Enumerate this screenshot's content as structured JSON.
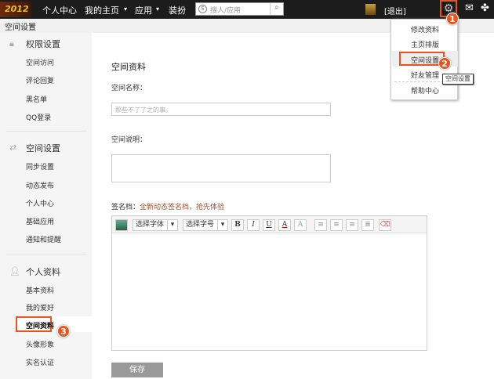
{
  "topbar": {
    "logo": "2012",
    "nav": [
      "个人中心",
      "我的主页",
      "应用",
      "装扮"
    ],
    "search_placeholder": "搜人/应用",
    "logout": "[退出]"
  },
  "breadcrumb": "空间设置",
  "sidebar": {
    "sections": [
      {
        "title": "权限设置",
        "icon": "lock-icon",
        "items": [
          "空间访问",
          "评论回复",
          "黑名单",
          "QQ登录"
        ]
      },
      {
        "title": "空间设置",
        "icon": "sync-icon",
        "items": [
          "同步设置",
          "动态发布",
          "个人中心",
          "基础应用",
          "通知和提醒"
        ]
      },
      {
        "title": "个人资料",
        "icon": "user-icon",
        "items": [
          "基本资料",
          "我的爱好",
          "空间资料",
          "头像形象",
          "实名认证"
        ]
      }
    ],
    "active": "空间资料"
  },
  "main": {
    "title": "空间资料",
    "name_label": "空间名称：",
    "name_value": "那些不了了之的事。",
    "desc_label": "空间说明：",
    "desc_value": "",
    "sig_label": "签名档：",
    "sig_link": "全新动态签名档，抢先体验",
    "toolbar": {
      "font": "选择字体",
      "size": "选择字号",
      "bold": "B",
      "italic": "I",
      "underline": "U",
      "color": "A",
      "bg": "A"
    },
    "save": "保存"
  },
  "menu": {
    "items": [
      "修改资料",
      "主页排版",
      "空间设置",
      "好友管理",
      "帮助中心"
    ],
    "tooltip": "空间设置"
  },
  "badges": [
    "1",
    "2",
    "3"
  ],
  "colors": {
    "accent": "#e8541e",
    "link": "#a0522d"
  }
}
